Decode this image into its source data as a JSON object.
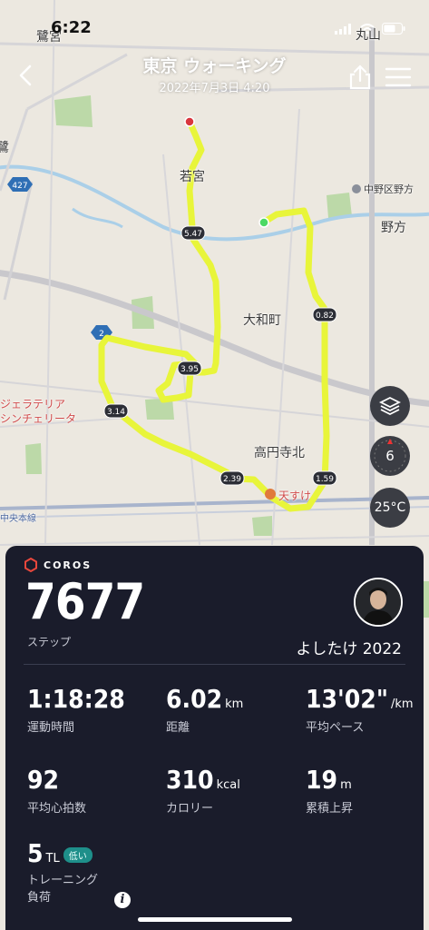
{
  "status_bar": {
    "time": "6:22"
  },
  "header": {
    "title": "東京 ウォーキング",
    "date": "2022年7月3日 4:20"
  },
  "map": {
    "labels": {
      "sagimiya": "鷺宮",
      "maruyama": "丸山",
      "wakamiya": "若宮",
      "nakano_sports": "中野区野方",
      "nogata": "野方",
      "yamatocho": "大和町",
      "koenjikita": "高円寺北",
      "gelateria": "ジェラテリア",
      "gelateria2": "シンチェリータ",
      "tensuke": "天すけ",
      "chuo_line": "中央本線",
      "road_427": "427",
      "road_small": "2",
      "left_edge_char": "鷺"
    },
    "km_markers": [
      "0.82",
      "1.59",
      "2.39",
      "3.14",
      "3.95",
      "5.47"
    ],
    "route_color": "#e8f53a",
    "start_color": "#4cd964",
    "end_color": "#d9363e"
  },
  "map_controls": {
    "layers_icon": "layers-icon",
    "compass_value": "6",
    "temperature": "25°C"
  },
  "card": {
    "brand": "COROS",
    "steps_value": "7677",
    "steps_label": "ステップ",
    "username": "よしたけ 2022",
    "stats": [
      {
        "value": "1:18:28",
        "unit": "",
        "label": "運動時間"
      },
      {
        "value": "6.02",
        "unit": "km",
        "label": "距離"
      },
      {
        "value": "13'02\"",
        "unit": "/km",
        "label": "平均ペース"
      },
      {
        "value": "92",
        "unit": "",
        "label": "平均心拍数"
      },
      {
        "value": "310",
        "unit": "kcal",
        "label": "カロリー"
      },
      {
        "value": "19",
        "unit": "m",
        "label": "累積上昇"
      }
    ],
    "training": {
      "value": "5",
      "unit": "TL",
      "badge": "低い",
      "label_line1": "トレーニング",
      "label_line2": "負荷"
    }
  }
}
